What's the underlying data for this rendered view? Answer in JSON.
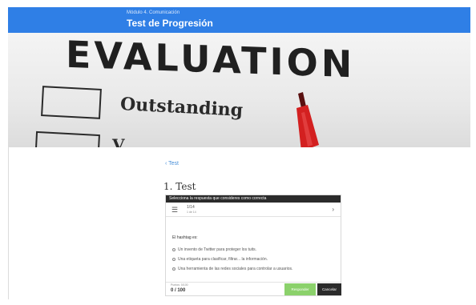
{
  "header": {
    "module": "Módulo 4. Comunicación",
    "title": "Test de Progresión"
  },
  "hero": {
    "heading": "EVALUATION",
    "item1": "Outstanding",
    "item2_fragment": "V"
  },
  "back_link": "‹ Test",
  "question_title": "1. Test",
  "card": {
    "instruction": "Selecciona la respuesta que consideres como correcta",
    "progress": "1/14",
    "progress_sub": "1 de 14",
    "stem": "El hashtag es:",
    "options": [
      "Un invento de Twitter para proteger los tuits.",
      "Una etiqueta para clasificar, filtrar... la información.",
      "Una herramienta de las redes sociales para controlar a usuarios."
    ],
    "score_label": "Puntos: 0/100",
    "score": "0 / 100",
    "submit": "Responder",
    "cancel": "Cancelar"
  },
  "colors": {
    "header_blue": "#2f7fe6",
    "submit_green": "#8bd16b",
    "dark": "#2b2b2b",
    "pen_red": "#d32020"
  }
}
